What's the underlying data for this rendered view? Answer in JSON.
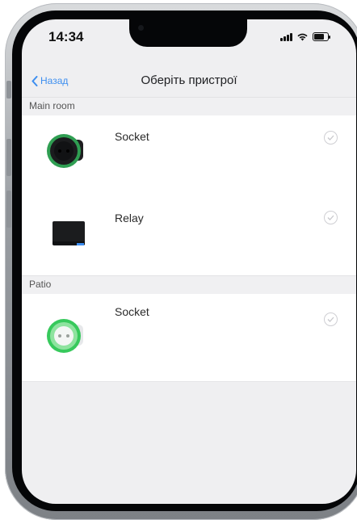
{
  "status_bar": {
    "time": "14:34",
    "icons": [
      "signal-icon",
      "wifi-icon",
      "battery-icon"
    ]
  },
  "nav": {
    "back_label": "Назад",
    "title": "Оберіть пристрої"
  },
  "sections": [
    {
      "header": "Main room",
      "devices": [
        {
          "name": "Socket",
          "icon": "socket-black-icon",
          "selected": false
        },
        {
          "name": "Relay",
          "icon": "relay-icon",
          "selected": false
        }
      ]
    },
    {
      "header": "Patio",
      "devices": [
        {
          "name": "Socket",
          "icon": "socket-white-icon",
          "selected": false
        }
      ]
    }
  ],
  "colors": {
    "accent": "#3c8ef0",
    "led_green": "#31c95a",
    "background": "#efeff1"
  }
}
